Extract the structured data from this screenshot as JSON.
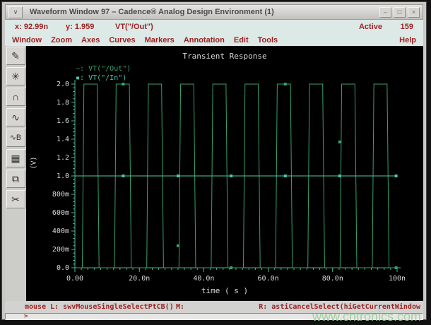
{
  "window": {
    "title": "Waveform Window 97 – Cadence® Analog Design Environment (1)",
    "menu_glyph": "∨",
    "controls": {
      "minimize": "–",
      "maximize": "□",
      "close": "×"
    }
  },
  "info_bar": {
    "x": "x: 92.99n",
    "y": "y: 1.959",
    "trace": "VT(\"/Out\")",
    "active_label": "Active",
    "active_count": "159"
  },
  "menu": {
    "items": [
      "Window",
      "Zoom",
      "Axes",
      "Curves",
      "Markers",
      "Annotation",
      "Edit",
      "Tools"
    ],
    "help": "Help"
  },
  "toolbar": {
    "icons": [
      {
        "name": "probe",
        "glyph": "✎"
      },
      {
        "name": "zoom-fit",
        "glyph": "✳"
      },
      {
        "name": "pan-arc",
        "glyph": "∩"
      },
      {
        "name": "strip-chart",
        "glyph": "∿"
      },
      {
        "name": "waveform-b",
        "glyph": "∿B"
      },
      {
        "name": "calculator",
        "glyph": "▦"
      },
      {
        "name": "copy-window",
        "glyph": "⧉"
      },
      {
        "name": "cut-window",
        "glyph": "✂"
      }
    ]
  },
  "chart_data": {
    "type": "line",
    "title": "Transient Response",
    "xlabel": "time ( s )",
    "ylabel": "(V)",
    "xlim": [
      0,
      100
    ],
    "ylim": [
      0,
      2
    ],
    "x_unit": "ns",
    "grid": false,
    "legend_position": "top-left",
    "background": "#000000",
    "axis_color": "#49b394",
    "tick_label_color": "#d6ddd6",
    "x_ticks": {
      "values": [
        0,
        20,
        40,
        60,
        80,
        100
      ],
      "labels": [
        "0.00",
        "20.0n",
        "40.0n",
        "60.0n",
        "80.0n",
        "100n"
      ]
    },
    "y_ticks": {
      "values": [
        0,
        0.2,
        0.4,
        0.6,
        0.8,
        1.0,
        1.2,
        1.4,
        1.6,
        1.8,
        2.0
      ],
      "labels": [
        "0.0",
        "200m",
        "400m",
        "600m",
        "800m",
        "1.0",
        "1.2",
        "1.4",
        "1.6",
        "1.8",
        "2.0"
      ]
    },
    "x_minor_step": 2,
    "y_minor_step": 0.04,
    "series": [
      {
        "name": "VT(\"/Out\")",
        "color": "#36a26c",
        "shape": "square-wave",
        "wave": {
          "n_periods": 10,
          "period": 10,
          "low": 0,
          "high": 2,
          "rise_start": 2.3,
          "rise_end": 2.8,
          "fall_start": 6.9,
          "fall_end": 7.5
        },
        "point_markers": [
          [
            15,
            2.0
          ],
          [
            32,
            0.24
          ],
          [
            48.5,
            0.0
          ],
          [
            65.3,
            2.0
          ],
          [
            82.2,
            1.37
          ],
          [
            99.7,
            0.0
          ]
        ]
      },
      {
        "name": "VT(\"/In\")",
        "color": "#4cc7ac",
        "shape": "step",
        "segments": [
          {
            "points": [
              [
                0,
                0
              ],
              [
                0,
                1.0
              ]
            ],
            "dashed": true
          },
          {
            "points": [
              [
                0,
                1.0
              ],
              [
                100,
                1.0
              ]
            ],
            "dashed": false
          }
        ],
        "point_markers": [
          [
            15,
            1.0
          ],
          [
            32,
            1.0
          ],
          [
            48.5,
            1.0
          ],
          [
            65.3,
            1.0
          ],
          [
            82.2,
            1.0
          ],
          [
            99.7,
            1.0
          ]
        ]
      }
    ],
    "legend": [
      {
        "marker": "–:",
        "label": "VT(\"/Out\")"
      },
      {
        "marker": "▪:",
        "label": "VT(\"/In\")"
      }
    ]
  },
  "status_bar": {
    "left": "mouse L: swvMouseSingleSelectPtCB()",
    "middle": "M:",
    "right": "R: astiCancelSelect(hiGetCurrentWindow"
  },
  "prompt": ">",
  "watermark": "www.cntronics.com",
  "colors": {
    "accent_text": "#9b2323",
    "bars_background": "#dde9e7",
    "plot_background": "#000000",
    "out_trace": "#36a26c",
    "in_trace": "#4cc7ac"
  }
}
